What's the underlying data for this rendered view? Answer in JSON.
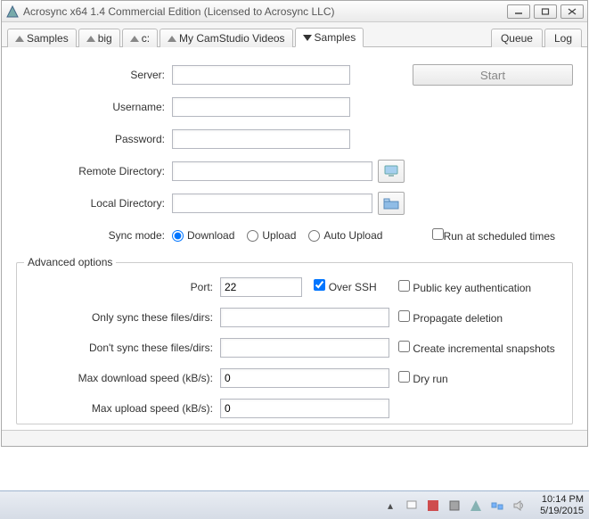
{
  "window": {
    "title": "Acrosync x64 1.4 Commercial Edition (Licensed to Acrosync LLC)"
  },
  "tabs": {
    "items": [
      {
        "label": "Samples",
        "active": false,
        "dir": "up"
      },
      {
        "label": "big",
        "active": false,
        "dir": "up"
      },
      {
        "label": "c:",
        "active": false,
        "dir": "up"
      },
      {
        "label": "My CamStudio Videos",
        "active": false,
        "dir": "up"
      },
      {
        "label": "Samples",
        "active": true,
        "dir": "down"
      }
    ],
    "right": {
      "queue": "Queue",
      "log": "Log"
    }
  },
  "form": {
    "server_label": "Server:",
    "server_value": "",
    "start_label": "Start",
    "username_label": "Username:",
    "username_value": "",
    "password_label": "Password:",
    "password_value": "",
    "remote_dir_label": "Remote Directory:",
    "remote_dir_value": "",
    "local_dir_label": "Local Directory:",
    "local_dir_value": "",
    "sync_mode_label": "Sync mode:",
    "download": "Download",
    "upload": "Upload",
    "auto_upload": "Auto Upload",
    "run_scheduled": "Run at scheduled times"
  },
  "advanced": {
    "legend": "Advanced options",
    "port_label": "Port:",
    "port_value": "22",
    "over_ssh": "Over SSH",
    "pubkey": "Public key authentication",
    "only_sync_label": "Only sync these files/dirs:",
    "only_sync_value": "",
    "propagate": "Propagate deletion",
    "dont_sync_label": "Don't sync these files/dirs:",
    "dont_sync_value": "",
    "incremental": "Create incremental snapshots",
    "max_down_label": "Max download speed (kB/s):",
    "max_down_value": "0",
    "dryrun": "Dry run",
    "max_up_label": "Max upload speed (kB/s):",
    "max_up_value": "0"
  },
  "taskbar": {
    "time": "10:14 PM",
    "date": "5/19/2015"
  }
}
